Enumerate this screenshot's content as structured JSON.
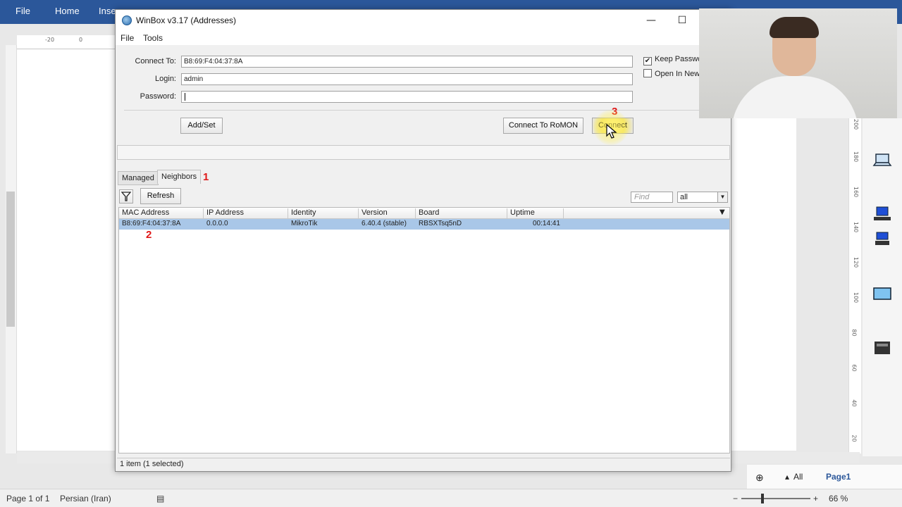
{
  "word": {
    "ribbon": {
      "file": "File",
      "home": "Home",
      "insert": "Inse"
    },
    "ruler_labels": {
      "minus20": "-20",
      "zero": "0"
    },
    "right_ruler_numbers": [
      "200",
      "180",
      "160",
      "140",
      "120",
      "100",
      "80",
      "60",
      "40",
      "20"
    ],
    "status": {
      "page": "Page 1 of 1",
      "language": "Persian (Iran)",
      "zoom": "66 %"
    },
    "nav": {
      "all": "All",
      "page": "Page1"
    }
  },
  "winbox": {
    "title": "WinBox v3.17 (Addresses)",
    "window_buttons": {
      "minimize": "—",
      "maximize": "☐"
    },
    "menu": {
      "file": "File",
      "tools": "Tools"
    },
    "form": {
      "connect_to_label": "Connect To:",
      "connect_to_value": "B8:69:F4:04:37:8A",
      "login_label": "Login:",
      "login_value": "admin",
      "password_label": "Password:",
      "password_value": "",
      "keep_password": "Keep Passwo",
      "open_in_new": "Open In New"
    },
    "buttons": {
      "add_set": "Add/Set",
      "connect_romon": "Connect To RoMON",
      "connect": "Connect"
    },
    "tabs": {
      "managed": "Managed",
      "neighbors": "Neighbors"
    },
    "annotations": {
      "one": "1",
      "two": "2",
      "three": "3"
    },
    "toolbar": {
      "refresh": "Refresh",
      "find_placeholder": "Find",
      "filter_value": "all"
    },
    "table": {
      "columns": [
        "MAC Address",
        "IP Address",
        "Identity",
        "Version",
        "Board",
        "Uptime"
      ],
      "rows": [
        [
          "B8:69:F4:04:37:8A",
          "0.0.0.0",
          "MikroTik",
          "6.40.4 (stable)",
          "RBSXTsq5nD",
          "00:14:41"
        ]
      ]
    },
    "status": "1 item (1 selected)"
  },
  "colors": {
    "ribbon": "#2b579a",
    "selection": "#a9c7e8",
    "annotation": "#e01818"
  }
}
